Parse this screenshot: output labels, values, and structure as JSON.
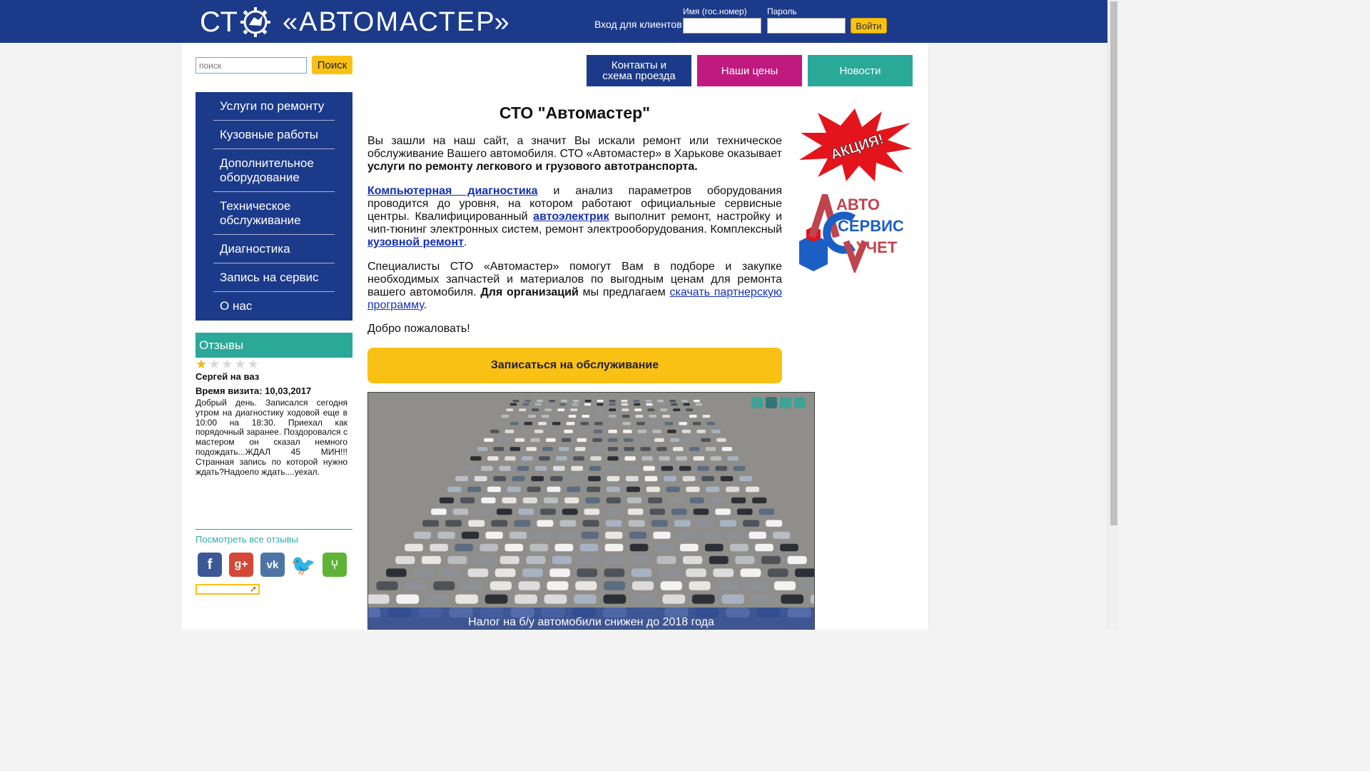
{
  "header": {
    "logo_prefix": "СТ",
    "logo_name": "«АВТОМАСТЕР»",
    "login_label": "Вход для клиентов",
    "username_label": "Имя (гос.номер)",
    "password_label": "Пароль",
    "login_button": "Войти"
  },
  "search": {
    "placeholder": "поиск",
    "button": "Поиск"
  },
  "nav": {
    "contacts": "Контакты и схема проезда",
    "prices": "Наши цены",
    "news": "Новости"
  },
  "sidebar": {
    "items": [
      {
        "label": "Услуги по ремонту"
      },
      {
        "label": "Кузовные работы"
      },
      {
        "label": "Дополнительное оборудование"
      },
      {
        "label": "Техническое обслуживание"
      },
      {
        "label": "Диагностика"
      },
      {
        "label": "Запись на сервис"
      },
      {
        "label": "О нас"
      }
    ]
  },
  "reviews": {
    "title": "Отзывы",
    "rating": 1,
    "rating_max": 5,
    "author": "Сергей на ваз",
    "visit_date": "Время визита: 10,03,2017",
    "text": "Добрый день. Записался сегодня утром на диагностику ходовой еще в 10:00 на 18:30. Приехал как порядочный заранее. Поздоровался с мастером он сказал немного подождать...ЖДАЛ 45 МИН!!! Странная запись по которой нужно ждать?Надоело ждать....уехал.",
    "view_all": "Посмотреть все отзывы"
  },
  "social": [
    "facebook-icon",
    "google-plus-icon",
    "vk-icon",
    "twitter-icon",
    "tripadvisor-icon"
  ],
  "main": {
    "title": "СТО \"Автомастер\"",
    "p1_text": "Вы зашли на наш сайт, а значит Вы искали ремонт или техническое обслуживание Вашего автомобиля. СТО «Автомастер» в Харькове оказывает ",
    "p1_bold": "услуги по ремонту легкового и грузового автотранспорта.",
    "p2_link1": "Компьютерная диагностика",
    "p2_text1": " и анализ параметров оборудования проводится до уровня, на котором работают официальные сервисные центры. Квалифицированный ",
    "p2_link2": "автоэлектрик",
    "p2_text2": " выполнит ремонт, настройку и чип-тюнинг электронных систем, ремонт электрооборудования. Комплексный ",
    "p2_link3": "кузовной ремонт",
    "p2_text3": ".",
    "p3_text": "Специалисты СТО «Автомастер» помогут Вам в подборе и закупке необходимых запчастей и материалов по выгодным ценам для ремонта вашего автомобиля. ",
    "p3_bold": "Для организаций",
    "p3_text2": " мы предлагаем ",
    "p3_link": "скачать партнерскую программу",
    "p3_end": ".",
    "welcome": "Добро пожаловать!",
    "cta": "Записаться на обслуживание"
  },
  "slider": {
    "caption": "Налог на б/у автомобили снижен до 2018 года",
    "dots": 4,
    "active_dot": 2
  },
  "banners": {
    "promo": "АКЦИЯ!",
    "autoservis_line1": "АВТО",
    "autoservis_line2": "СЕРВИС",
    "autoservis_line3": "УЧЕТ"
  },
  "colors": {
    "header_blue": "#1c3a8a",
    "magenta": "#c0197f",
    "teal": "#2aa898",
    "yellow": "#f8c114"
  }
}
